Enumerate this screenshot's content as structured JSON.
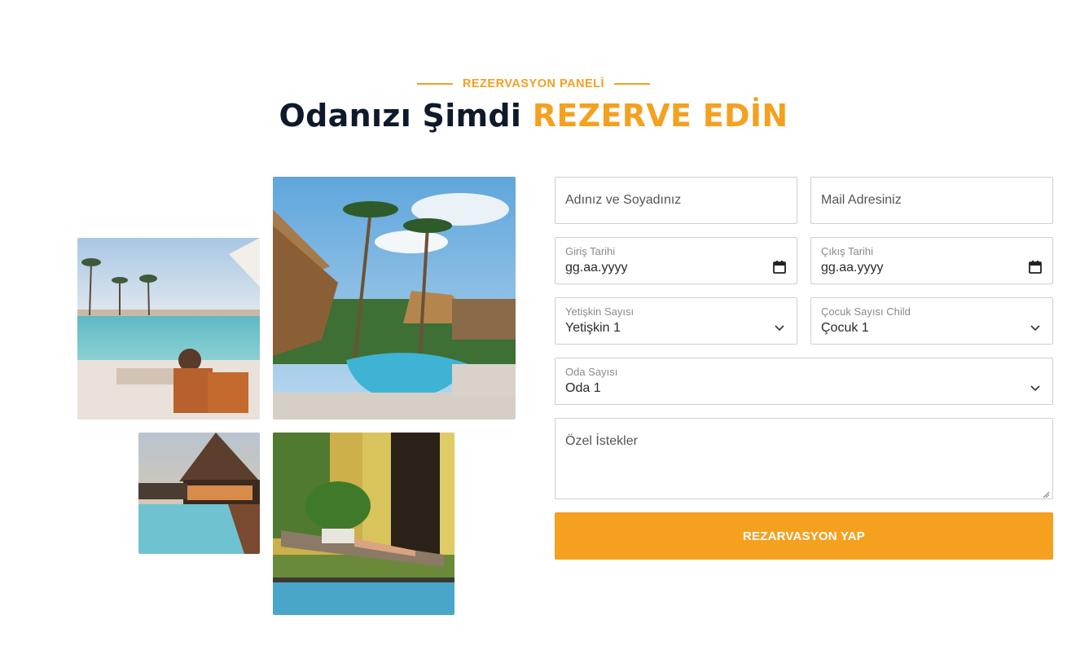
{
  "section": {
    "eyebrow": "REZERVASYON PANELİ",
    "title_main": "Odanızı Şimdi",
    "title_accent": "REZERVE EDİN"
  },
  "colors": {
    "accent": "#f5a01f",
    "heading": "#0e1a2b",
    "border": "#cfcfcf"
  },
  "form": {
    "name_placeholder": "Adınız ve Soyadınız",
    "email_placeholder": "Mail Adresiniz",
    "checkin": {
      "label": "Giriş Tarihi",
      "value": "gg.aa.yyyy"
    },
    "checkout": {
      "label": "Çıkış Tarihi",
      "value": "gg.aa.yyyy"
    },
    "adults": {
      "label": "Yetişkin Sayısı",
      "value": "Yetişkin 1"
    },
    "children": {
      "label": "Çocuk Sayısı Child",
      "value": "Çocuk 1"
    },
    "rooms": {
      "label": "Oda Sayısı",
      "value": "Oda 1"
    },
    "notes_placeholder": "Özel İstekler",
    "submit_label": "REZARVASYON YAP"
  },
  "icons": [
    "calendar-icon",
    "chevron-down-icon",
    "resize-handle-icon"
  ]
}
